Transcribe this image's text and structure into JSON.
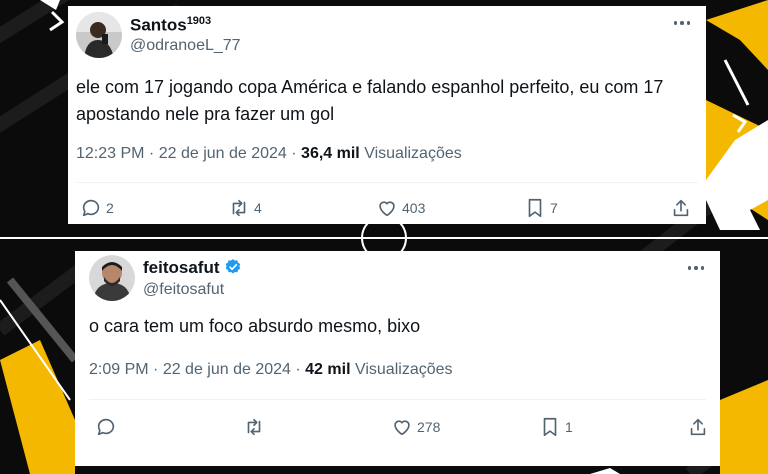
{
  "tweets": [
    {
      "name": "Santos",
      "name_suffix": "1903",
      "handle": "@odranoeL_77",
      "text": "ele com 17 jogando copa América e falando espanhol perfeito, eu com 17 apostando nele pra fazer um gol",
      "time": "12:23 PM",
      "date": "22 de jun de 2024",
      "views": "36,4 mil",
      "views_label": "Visualizações",
      "replies": "2",
      "retweets": "4",
      "likes": "403",
      "bookmarks": "7",
      "verified": false
    },
    {
      "name": "feitosafut",
      "handle": "@feitosafut",
      "text": "o cara tem um foco absurdo mesmo, bixo",
      "time": "2:09 PM",
      "date": "22 de jun de 2024",
      "views": "42 mil",
      "views_label": "Visualizações",
      "replies": "",
      "retweets": "",
      "likes": "278",
      "bookmarks": "1",
      "verified": true
    }
  ],
  "icons": [
    "more-icon",
    "reply-icon",
    "retweet-icon",
    "like-icon",
    "bookmark-icon",
    "share-icon",
    "verified-badge-icon"
  ],
  "colors": {
    "accent": "#f5b800",
    "verified": "#1d9bf0",
    "muted": "#536471",
    "text": "#0f1419",
    "background": "#0b0b0b"
  }
}
